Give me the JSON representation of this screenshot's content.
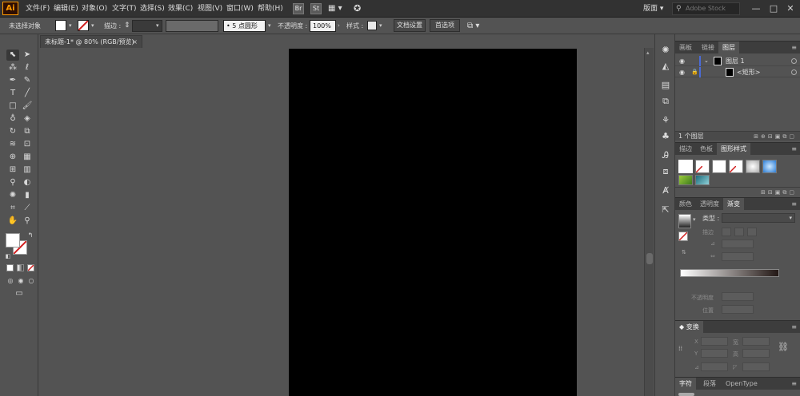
{
  "app": {
    "logo": "Ai"
  },
  "menu": {
    "items": [
      "文件(F)",
      "编辑(E)",
      "对象(O)",
      "文字(T)",
      "选择(S)",
      "效果(C)",
      "视图(V)",
      "窗口(W)",
      "帮助(H)"
    ],
    "br_label": "Br",
    "st_label": "St",
    "workspace_label": "版面",
    "search_placeholder": "Adobe Stock",
    "minimize": "—",
    "restore": "□",
    "close": "✕"
  },
  "control": {
    "selection_status": "未选择对象",
    "stroke_label": "描边",
    "brush_value": "5 点圆形",
    "opacity_label": "不透明度",
    "opacity_value": "100%",
    "style_label": "样式",
    "doc_setup_label": "文档设置",
    "prefs_label": "首选项",
    "colors": {
      "fill": "#ffffff",
      "stroke_none_line": "#d11f1f"
    }
  },
  "document": {
    "tab_title": "未标题-1* @ 80% (RGB/预览)",
    "close_glyph": "×",
    "artboard_color": "#000000"
  },
  "toolbar": {
    "tools": [
      "selection",
      "direct-selection",
      "magic-wand",
      "lasso",
      "pen",
      "curvature",
      "type",
      "line-segment",
      "rectangle",
      "paintbrush",
      "shaper",
      "eraser",
      "rotate",
      "scale",
      "width",
      "free-transform",
      "shape-builder",
      "perspective-grid",
      "mesh",
      "gradient",
      "eyedropper",
      "blend",
      "symbol-sprayer",
      "column-graph",
      "artboard",
      "slice",
      "hand",
      "zoom"
    ],
    "fill_color": "#ffffff",
    "stroke_color": "#ffffff"
  },
  "layers_panel": {
    "tabs": [
      "画板",
      "链接",
      "图层"
    ],
    "active_tab": "图层",
    "layers": [
      {
        "name": "图层 1"
      },
      {
        "name": "<矩形>"
      }
    ],
    "footer_count": "1 个图层"
  },
  "graphic_styles_panel": {
    "tabs": [
      "描边",
      "色板",
      "图形样式"
    ],
    "active_tab": "图形样式"
  },
  "gradient_panel": {
    "tabs": [
      "颜色",
      "透明度",
      "渐变"
    ],
    "active_tab": "渐变",
    "type_label": "类型",
    "stroke_label": "描边",
    "opacity_label": "不透明度",
    "position_label": "位置"
  },
  "transform_panel": {
    "tab": "变换",
    "x_label": "X",
    "y_label": "Y",
    "w_label": "宽",
    "h_label": "高"
  },
  "character_panel": {
    "tabs": [
      "字符",
      "段落",
      "OpenType"
    ],
    "active_tab": "字符"
  }
}
